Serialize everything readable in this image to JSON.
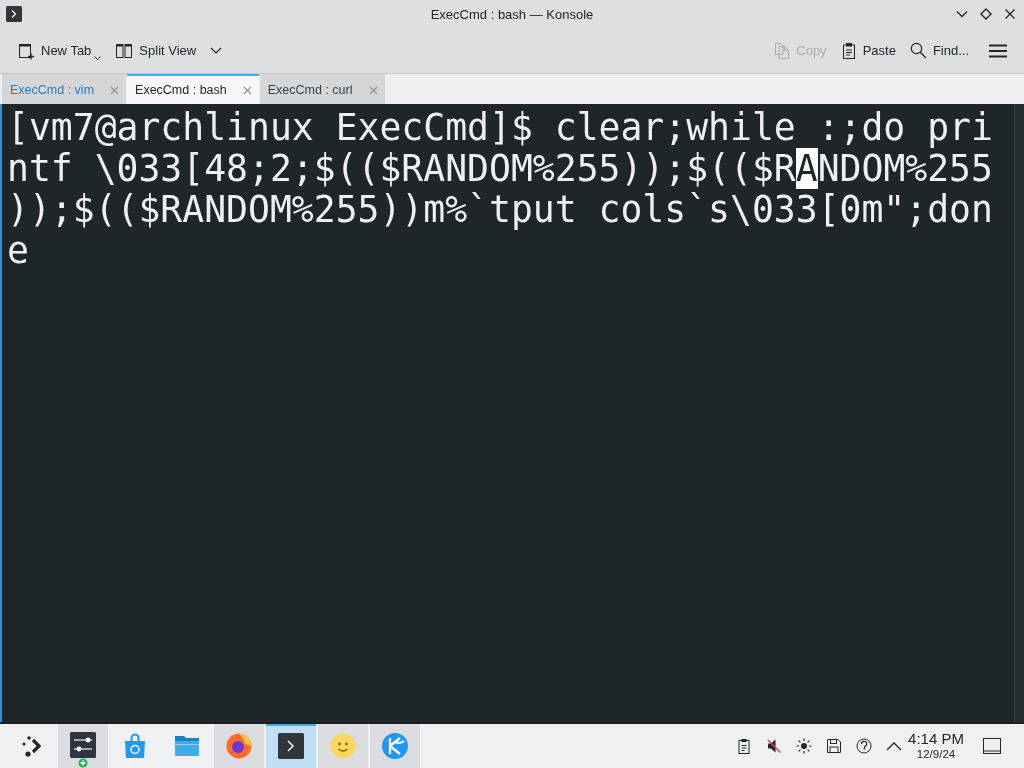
{
  "window": {
    "title": "ExecCmd : bash — Konsole"
  },
  "toolbar": {
    "left": [
      {
        "kind": "new-tab",
        "label": "New Tab"
      },
      {
        "kind": "split-view",
        "label": "Split View"
      }
    ],
    "right": [
      {
        "kind": "copy",
        "label": "Copy",
        "disabled": true
      },
      {
        "kind": "paste",
        "label": "Paste",
        "disabled": false
      },
      {
        "kind": "find",
        "label": "Find...",
        "disabled": false
      }
    ]
  },
  "tabs": [
    {
      "label": "ExecCmd : vim",
      "selected": false,
      "highlighted": true
    },
    {
      "label": "ExecCmd : bash",
      "selected": true,
      "highlighted": false
    },
    {
      "label": "ExecCmd : curl",
      "selected": false,
      "highlighted": false
    }
  ],
  "terminal": {
    "lines": [
      {
        "segments": [
          {
            "kind": "text",
            "text": "[vm7@archlinux ExecCmd]$ clear;while :;do pri"
          }
        ]
      },
      {
        "segments": [
          {
            "kind": "text",
            "text": "ntf \\033[48;2;$(($RANDOM%255));$(($R"
          },
          {
            "kind": "cursor",
            "text": "A"
          },
          {
            "kind": "text",
            "text": "NDOM%255"
          }
        ]
      },
      {
        "segments": [
          {
            "kind": "text",
            "text": "));$(($RANDOM%255))m%`tput cols`s\\033[0m\";don"
          }
        ]
      },
      {
        "segments": [
          {
            "kind": "text",
            "text": "e"
          }
        ]
      }
    ]
  },
  "taskbar": {
    "tasks": [
      {
        "kind": "settings",
        "running": true,
        "active": false
      },
      {
        "kind": "store",
        "running": false,
        "active": false
      },
      {
        "kind": "files",
        "running": false,
        "active": false
      },
      {
        "kind": "browser",
        "running": true,
        "active": false
      },
      {
        "kind": "terminal",
        "running": true,
        "active": true
      },
      {
        "kind": "smiley",
        "running": true,
        "active": false
      },
      {
        "kind": "globe",
        "running": true,
        "active": false
      }
    ],
    "clock": {
      "time": "4:14 PM",
      "date": "12/9/24"
    }
  }
}
